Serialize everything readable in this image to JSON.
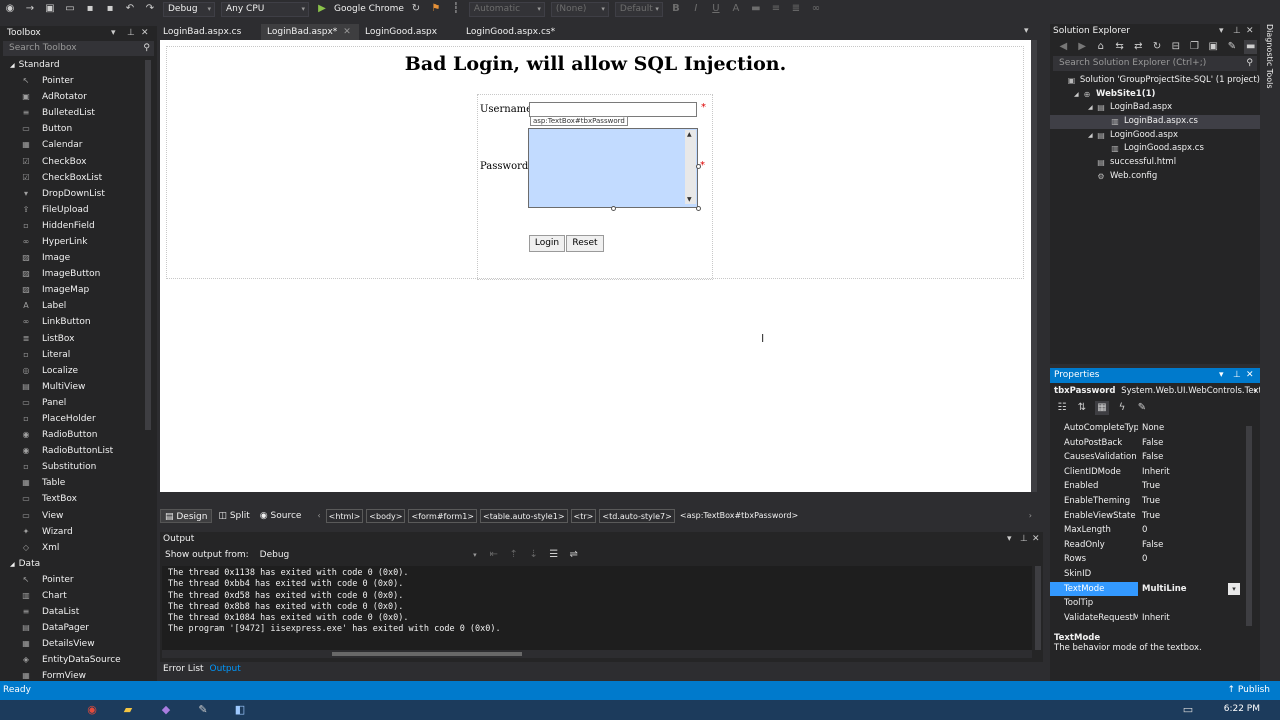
{
  "toolbar": {
    "config": "Debug",
    "platform": "Any CPU",
    "browser": "Google Chrome",
    "combo_automatic": "Automatic",
    "combo_none": "(None)",
    "combo_default": "Default",
    "format_buttons": [
      "B",
      "I",
      "U"
    ]
  },
  "toolbox": {
    "title": "Toolbox",
    "search_placeholder": "Search Toolbox",
    "groups": [
      {
        "label": "Standard",
        "items": [
          "Pointer",
          "AdRotator",
          "BulletedList",
          "Button",
          "Calendar",
          "CheckBox",
          "CheckBoxList",
          "DropDownList",
          "FileUpload",
          "HiddenField",
          "HyperLink",
          "Image",
          "ImageButton",
          "ImageMap",
          "Label",
          "LinkButton",
          "ListBox",
          "Literal",
          "Localize",
          "MultiView",
          "Panel",
          "PlaceHolder",
          "RadioButton",
          "RadioButtonList",
          "Substitution",
          "Table",
          "TextBox",
          "View",
          "Wizard",
          "Xml"
        ]
      },
      {
        "label": "Data",
        "items": [
          "Pointer",
          "Chart",
          "DataList",
          "DataPager",
          "DetailsView",
          "EntityDataSource",
          "FormView"
        ]
      }
    ]
  },
  "tabs": [
    {
      "label": "LoginBad.aspx.cs",
      "active": false
    },
    {
      "label": "LoginBad.aspx*",
      "active": true
    },
    {
      "label": "LoginGood.aspx",
      "active": false
    },
    {
      "label": "LoginGood.aspx.cs*",
      "active": false
    }
  ],
  "design": {
    "heading": "Bad Login, will allow SQL Injection.",
    "username_label": "Username",
    "password_label": "Password",
    "required_marker": "*",
    "tag_tooltip": "asp:TextBox#tbxPassword",
    "login_button": "Login",
    "reset_button": "Reset"
  },
  "viewbar": {
    "design": "Design",
    "split": "Split",
    "source": "Source",
    "breadcrumbs": [
      "<html>",
      "<body>",
      "<form#form1>",
      "<table.auto-style1>",
      "<tr>",
      "<td.auto-style7>",
      "<asp:TextBox#tbxPassword>"
    ]
  },
  "output": {
    "title": "Output",
    "show_from_label": "Show output from:",
    "show_from_value": "Debug",
    "lines": [
      "The thread 0x1138 has exited with code 0 (0x0).",
      "The thread 0xbb4 has exited with code 0 (0x0).",
      "The thread 0xd58 has exited with code 0 (0x0).",
      "The thread 0x8b8 has exited with code 0 (0x0).",
      "The thread 0x1084 has exited with code 0 (0x0).",
      "The program '[9472] iisexpress.exe' has exited with code 0 (0x0)."
    ]
  },
  "bottom_tabs": [
    "Error List",
    "Output"
  ],
  "solution_explorer": {
    "title": "Solution Explorer",
    "search_placeholder": "Search Solution Explorer (Ctrl+;)",
    "nodes": [
      {
        "label": "Solution 'GroupProjectSite-SQL' (1 project)",
        "level": 0,
        "icon": "solution-icon",
        "bold": false,
        "twisty": ""
      },
      {
        "label": "WebSite1(1)",
        "level": 1,
        "icon": "website-icon",
        "bold": true,
        "twisty": "◢"
      },
      {
        "label": "LoginBad.aspx",
        "level": 2,
        "icon": "aspx-file-icon",
        "bold": false,
        "twisty": "◢"
      },
      {
        "label": "LoginBad.aspx.cs",
        "level": 3,
        "icon": "cs-file-icon",
        "bold": false,
        "twisty": "",
        "selected": true
      },
      {
        "label": "LoginGood.aspx",
        "level": 2,
        "icon": "aspx-file-icon",
        "bold": false,
        "twisty": "◢"
      },
      {
        "label": "LoginGood.aspx.cs",
        "level": 3,
        "icon": "cs-file-icon",
        "bold": false,
        "twisty": ""
      },
      {
        "label": "successful.html",
        "level": 2,
        "icon": "html-file-icon",
        "bold": false,
        "twisty": ""
      },
      {
        "label": "Web.config",
        "level": 2,
        "icon": "config-file-icon",
        "bold": false,
        "twisty": ""
      }
    ]
  },
  "diagnostic_tools": "Diagnostic Tools",
  "properties": {
    "title": "Properties",
    "object_name": "tbxPassword",
    "object_type": "System.Web.UI.WebControls.Text",
    "rows": [
      {
        "name": "AutoCompleteType",
        "value": "None"
      },
      {
        "name": "AutoPostBack",
        "value": "False"
      },
      {
        "name": "CausesValidation",
        "value": "False"
      },
      {
        "name": "ClientIDMode",
        "value": "Inherit"
      },
      {
        "name": "Enabled",
        "value": "True"
      },
      {
        "name": "EnableTheming",
        "value": "True"
      },
      {
        "name": "EnableViewState",
        "value": "True"
      },
      {
        "name": "MaxLength",
        "value": "0"
      },
      {
        "name": "ReadOnly",
        "value": "False"
      },
      {
        "name": "Rows",
        "value": "0"
      },
      {
        "name": "SkinID",
        "value": ""
      },
      {
        "name": "TextMode",
        "value": "MultiLine",
        "selected": true
      },
      {
        "name": "ToolTip",
        "value": ""
      },
      {
        "name": "ValidateRequestMode",
        "value": "Inherit"
      }
    ],
    "desc_title": "TextMode",
    "desc_text": "The behavior mode of the textbox."
  },
  "status": {
    "left": "Ready",
    "publish": "Publish"
  },
  "taskbar": {
    "clock": "6:22 PM"
  },
  "colors": {
    "accent": "#007acc",
    "selected_row": "#3399ff",
    "editor_bg": "#ffffff",
    "ide_bg": "#2d2d30"
  }
}
